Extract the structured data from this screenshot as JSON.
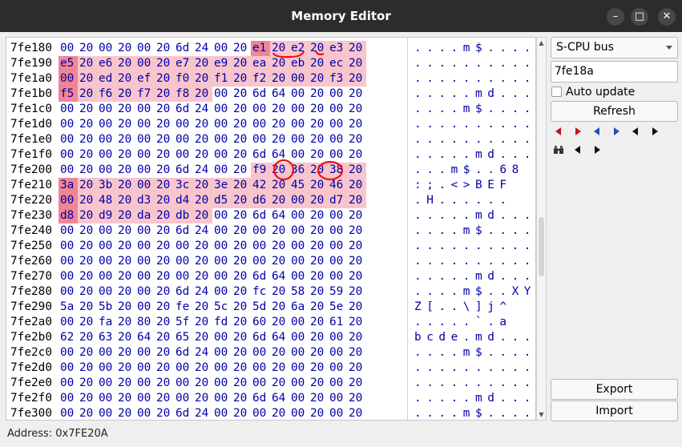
{
  "window": {
    "title": "Memory Editor",
    "minimize_glyph": "–",
    "maximize_glyph": "□",
    "close_glyph": "✕"
  },
  "hex_rows": [
    {
      "address": "7fe180",
      "bytes": [
        "00",
        "20",
        "00",
        "20",
        "00",
        "20",
        "6d",
        "24",
        "00",
        "20",
        "e1",
        "20",
        "e2",
        "20",
        "e3",
        "20"
      ],
      "ascii": [
        ".",
        ".",
        ".",
        ".",
        "m",
        "$",
        ".",
        ".",
        ".",
        "."
      ]
    },
    {
      "address": "7fe190",
      "bytes": [
        "e5",
        "20",
        "e6",
        "20",
        "00",
        "20",
        "e7",
        "20",
        "e9",
        "20",
        "ea",
        "20",
        "eb",
        "20",
        "ec",
        "20"
      ],
      "ascii": [
        ".",
        ".",
        ".",
        ".",
        ".",
        ".",
        ".",
        ".",
        ".",
        "."
      ]
    },
    {
      "address": "7fe1a0",
      "bytes": [
        "00",
        "20",
        "ed",
        "20",
        "ef",
        "20",
        "f0",
        "20",
        "f1",
        "20",
        "f2",
        "20",
        "00",
        "20",
        "f3",
        "20"
      ],
      "ascii": [
        ".",
        ".",
        ".",
        ".",
        ".",
        ".",
        ".",
        ".",
        ".",
        "."
      ]
    },
    {
      "address": "7fe1b0",
      "bytes": [
        "f5",
        "20",
        "f6",
        "20",
        "f7",
        "20",
        "f8",
        "20",
        "00",
        "20",
        "6d",
        "64",
        "00",
        "20",
        "00",
        "20"
      ],
      "ascii": [
        ".",
        ".",
        ".",
        ".",
        ".",
        "m",
        "d",
        ".",
        ".",
        "."
      ]
    },
    {
      "address": "7fe1c0",
      "bytes": [
        "00",
        "20",
        "00",
        "20",
        "00",
        "20",
        "6d",
        "24",
        "00",
        "20",
        "00",
        "20",
        "00",
        "20",
        "00",
        "20"
      ],
      "ascii": [
        ".",
        ".",
        ".",
        ".",
        "m",
        "$",
        ".",
        ".",
        ".",
        "."
      ]
    },
    {
      "address": "7fe1d0",
      "bytes": [
        "00",
        "20",
        "00",
        "20",
        "00",
        "20",
        "00",
        "20",
        "00",
        "20",
        "00",
        "20",
        "00",
        "20",
        "00",
        "20"
      ],
      "ascii": [
        ".",
        ".",
        ".",
        ".",
        ".",
        ".",
        ".",
        ".",
        ".",
        "."
      ]
    },
    {
      "address": "7fe1e0",
      "bytes": [
        "00",
        "20",
        "00",
        "20",
        "00",
        "20",
        "00",
        "20",
        "00",
        "20",
        "00",
        "20",
        "00",
        "20",
        "00",
        "20"
      ],
      "ascii": [
        ".",
        ".",
        ".",
        ".",
        ".",
        ".",
        ".",
        ".",
        ".",
        "."
      ]
    },
    {
      "address": "7fe1f0",
      "bytes": [
        "00",
        "20",
        "00",
        "20",
        "00",
        "20",
        "00",
        "20",
        "00",
        "20",
        "6d",
        "64",
        "00",
        "20",
        "00",
        "20"
      ],
      "ascii": [
        ".",
        ".",
        ".",
        ".",
        ".",
        "m",
        "d",
        ".",
        ".",
        "."
      ]
    },
    {
      "address": "7fe200",
      "bytes": [
        "00",
        "20",
        "00",
        "20",
        "00",
        "20",
        "6d",
        "24",
        "00",
        "20",
        "f9",
        "20",
        "36",
        "20",
        "38",
        "20"
      ],
      "ascii": [
        ".",
        ".",
        ".",
        "m",
        "$",
        ".",
        ".",
        "6",
        "8"
      ]
    },
    {
      "address": "7fe210",
      "bytes": [
        "3a",
        "20",
        "3b",
        "20",
        "00",
        "20",
        "3c",
        "20",
        "3e",
        "20",
        "42",
        "20",
        "45",
        "20",
        "46",
        "20"
      ],
      "ascii": [
        ":",
        ";",
        ".",
        "<",
        ">",
        "B",
        "E",
        "F"
      ]
    },
    {
      "address": "7fe220",
      "bytes": [
        "00",
        "20",
        "48",
        "20",
        "d3",
        "20",
        "d4",
        "20",
        "d5",
        "20",
        "d6",
        "20",
        "00",
        "20",
        "d7",
        "20"
      ],
      "ascii": [
        ".",
        "H",
        ".",
        ".",
        ".",
        ".",
        ".",
        "."
      ]
    },
    {
      "address": "7fe230",
      "bytes": [
        "d8",
        "20",
        "d9",
        "20",
        "da",
        "20",
        "db",
        "20",
        "00",
        "20",
        "6d",
        "64",
        "00",
        "20",
        "00",
        "20"
      ],
      "ascii": [
        ".",
        ".",
        ".",
        ".",
        ".",
        "m",
        "d",
        ".",
        ".",
        "."
      ]
    },
    {
      "address": "7fe240",
      "bytes": [
        "00",
        "20",
        "00",
        "20",
        "00",
        "20",
        "6d",
        "24",
        "00",
        "20",
        "00",
        "20",
        "00",
        "20",
        "00",
        "20"
      ],
      "ascii": [
        ".",
        ".",
        ".",
        ".",
        "m",
        "$",
        ".",
        ".",
        ".",
        "."
      ]
    },
    {
      "address": "7fe250",
      "bytes": [
        "00",
        "20",
        "00",
        "20",
        "00",
        "20",
        "00",
        "20",
        "00",
        "20",
        "00",
        "20",
        "00",
        "20",
        "00",
        "20"
      ],
      "ascii": [
        ".",
        ".",
        ".",
        ".",
        ".",
        ".",
        ".",
        ".",
        ".",
        "."
      ]
    },
    {
      "address": "7fe260",
      "bytes": [
        "00",
        "20",
        "00",
        "20",
        "00",
        "20",
        "00",
        "20",
        "00",
        "20",
        "00",
        "20",
        "00",
        "20",
        "00",
        "20"
      ],
      "ascii": [
        ".",
        ".",
        ".",
        ".",
        ".",
        ".",
        ".",
        ".",
        ".",
        "."
      ]
    },
    {
      "address": "7fe270",
      "bytes": [
        "00",
        "20",
        "00",
        "20",
        "00",
        "20",
        "00",
        "20",
        "00",
        "20",
        "6d",
        "64",
        "00",
        "20",
        "00",
        "20"
      ],
      "ascii": [
        ".",
        ".",
        ".",
        ".",
        ".",
        "m",
        "d",
        ".",
        ".",
        "."
      ]
    },
    {
      "address": "7fe280",
      "bytes": [
        "00",
        "20",
        "00",
        "20",
        "00",
        "20",
        "6d",
        "24",
        "00",
        "20",
        "fc",
        "20",
        "58",
        "20",
        "59",
        "20"
      ],
      "ascii": [
        ".",
        ".",
        ".",
        ".",
        "m",
        "$",
        ".",
        ".",
        "X",
        "Y"
      ]
    },
    {
      "address": "7fe290",
      "bytes": [
        "5a",
        "20",
        "5b",
        "20",
        "00",
        "20",
        "fe",
        "20",
        "5c",
        "20",
        "5d",
        "20",
        "6a",
        "20",
        "5e",
        "20"
      ],
      "ascii": [
        "Z",
        "[",
        ".",
        ".",
        "\\",
        "]",
        "j",
        "^"
      ]
    },
    {
      "address": "7fe2a0",
      "bytes": [
        "00",
        "20",
        "fa",
        "20",
        "80",
        "20",
        "5f",
        "20",
        "fd",
        "20",
        "60",
        "20",
        "00",
        "20",
        "61",
        "20"
      ],
      "ascii": [
        ".",
        ".",
        ".",
        ".",
        ".",
        "`",
        ".",
        "a"
      ]
    },
    {
      "address": "7fe2b0",
      "bytes": [
        "62",
        "20",
        "63",
        "20",
        "64",
        "20",
        "65",
        "20",
        "00",
        "20",
        "6d",
        "64",
        "00",
        "20",
        "00",
        "20"
      ],
      "ascii": [
        "b",
        "c",
        "d",
        "e",
        ".",
        "m",
        "d",
        ".",
        ".",
        "."
      ]
    },
    {
      "address": "7fe2c0",
      "bytes": [
        "00",
        "20",
        "00",
        "20",
        "00",
        "20",
        "6d",
        "24",
        "00",
        "20",
        "00",
        "20",
        "00",
        "20",
        "00",
        "20"
      ],
      "ascii": [
        ".",
        ".",
        ".",
        ".",
        "m",
        "$",
        ".",
        ".",
        ".",
        "."
      ]
    },
    {
      "address": "7fe2d0",
      "bytes": [
        "00",
        "20",
        "00",
        "20",
        "00",
        "20",
        "00",
        "20",
        "00",
        "20",
        "00",
        "20",
        "00",
        "20",
        "00",
        "20"
      ],
      "ascii": [
        ".",
        ".",
        ".",
        ".",
        ".",
        ".",
        ".",
        ".",
        ".",
        "."
      ]
    },
    {
      "address": "7fe2e0",
      "bytes": [
        "00",
        "20",
        "00",
        "20",
        "00",
        "20",
        "00",
        "20",
        "00",
        "20",
        "00",
        "20",
        "00",
        "20",
        "00",
        "20"
      ],
      "ascii": [
        ".",
        ".",
        ".",
        ".",
        ".",
        ".",
        ".",
        ".",
        ".",
        "."
      ]
    },
    {
      "address": "7fe2f0",
      "bytes": [
        "00",
        "20",
        "00",
        "20",
        "00",
        "20",
        "00",
        "20",
        "00",
        "20",
        "6d",
        "64",
        "00",
        "20",
        "00",
        "20"
      ],
      "ascii": [
        ".",
        ".",
        ".",
        ".",
        ".",
        "m",
        "d",
        ".",
        ".",
        "."
      ]
    },
    {
      "address": "7fe300",
      "bytes": [
        "00",
        "20",
        "00",
        "20",
        "00",
        "20",
        "6d",
        "24",
        "00",
        "20",
        "00",
        "20",
        "00",
        "20",
        "00",
        "20"
      ],
      "ascii": [
        ".",
        ".",
        ".",
        ".",
        "m",
        "$",
        ".",
        ".",
        ".",
        "."
      ]
    }
  ],
  "sidebar": {
    "bus_select": "S-CPU bus",
    "address_input": "7fe18a",
    "auto_update_label": "Auto update",
    "auto_update_checked": false,
    "refresh_label": "Refresh",
    "export_label": "Export",
    "import_label": "Import",
    "nav_icons": [
      "red-left-arrow-icon",
      "red-right-arrow-icon",
      "blue-left-arrow-icon",
      "blue-right-arrow-icon",
      "black-left-arrow-icon",
      "black-right-arrow-icon",
      "binoculars-icon",
      "black-left-arrow-icon",
      "black-right-arrow-icon"
    ]
  },
  "statusbar": {
    "text": "Address: 0x7FE20A"
  },
  "colors": {
    "hex": "#0000aa",
    "highlight": "#ec5a6e",
    "annotation": "#ee1111",
    "titlebar": "#2c2c2c"
  }
}
